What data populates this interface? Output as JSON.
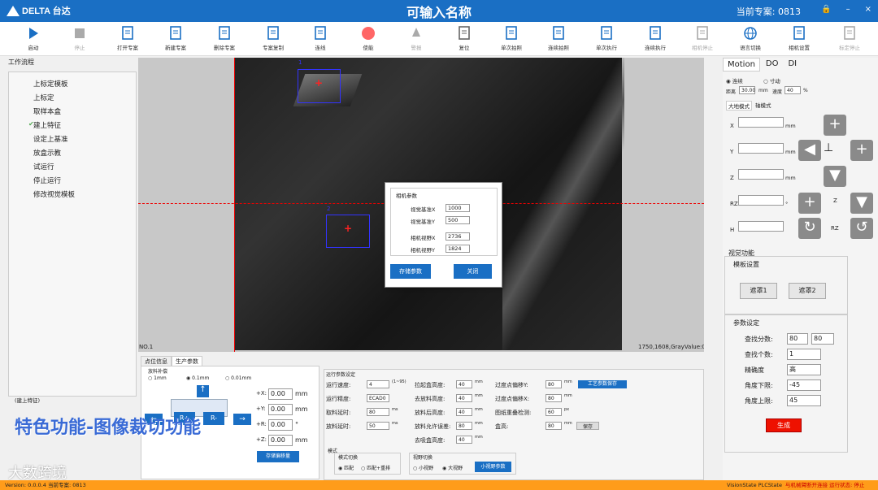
{
  "titlebar": {
    "brand": "DELTA 台达",
    "title": "可输入名称",
    "project_label": "当前专案: 0813",
    "lock": "🔒",
    "min": "–",
    "close": "×"
  },
  "toolbar": [
    {
      "label": "启动",
      "icon": "play-icon",
      "color": "#1a6fc4",
      "disabled": false
    },
    {
      "label": "停止",
      "icon": "stop-icon",
      "color": "#aaa",
      "disabled": true
    },
    {
      "label": "打开专案",
      "icon": "open-doc-icon",
      "color": "#1a6fc4",
      "disabled": false
    },
    {
      "label": "新建专案",
      "icon": "new-doc-icon",
      "color": "#1a6fc4",
      "disabled": false
    },
    {
      "label": "删除专案",
      "icon": "delete-doc-icon",
      "color": "#1a6fc4",
      "disabled": false
    },
    {
      "label": "专案复制",
      "icon": "copy-doc-icon",
      "color": "#1a6fc4",
      "disabled": false
    },
    {
      "label": "连线",
      "icon": "connect-icon",
      "color": "#1a6fc4",
      "disabled": false
    },
    {
      "label": "使能",
      "icon": "enable-icon",
      "color": "#f66",
      "disabled": false
    },
    {
      "label": "警报",
      "icon": "alarm-icon",
      "color": "#aaa",
      "disabled": true
    },
    {
      "label": "复位",
      "icon": "reset-icon",
      "color": "#666",
      "disabled": false
    },
    {
      "label": "单次拍照",
      "icon": "single-shot-icon",
      "color": "#1a6fc4",
      "disabled": false
    },
    {
      "label": "连续拍照",
      "icon": "continuous-shot-icon",
      "color": "#1a6fc4",
      "disabled": false
    },
    {
      "label": "单次执行",
      "icon": "single-run-icon",
      "color": "#1a6fc4",
      "disabled": false
    },
    {
      "label": "连续执行",
      "icon": "continuous-run-icon",
      "color": "#1a6fc4",
      "disabled": false
    },
    {
      "label": "相机停止",
      "icon": "camera-stop-icon",
      "color": "#aaa",
      "disabled": true
    },
    {
      "label": "语言切换",
      "icon": "globe-icon",
      "color": "#1a6fc4",
      "disabled": false
    },
    {
      "label": "相机设置",
      "icon": "camera-settings-icon",
      "color": "#1a6fc4",
      "disabled": false
    },
    {
      "label": "标定停止",
      "icon": "calib-stop-icon",
      "color": "#aaa",
      "disabled": true
    }
  ],
  "workflow": {
    "title": "工作流程",
    "items": [
      "上标定模板",
      "上标定",
      "取样本盒",
      "建上特征",
      "设定上基准",
      "放盒示教",
      "试运行",
      "停止运行",
      "修改视觉模板"
    ],
    "checked_index": 3,
    "status": "(建上特征)"
  },
  "canvas": {
    "no_label": "NO.1",
    "status_text": "1750,1608,GrayValue:0",
    "roi1_label": "1",
    "roi2_label": "2"
  },
  "dialog": {
    "group": "相机参数",
    "rows": [
      {
        "label": "视觉基准X",
        "value": "1000"
      },
      {
        "label": "视觉基准Y",
        "value": "500"
      },
      {
        "label": "相机视野X",
        "value": "2736"
      },
      {
        "label": "相机视野Y",
        "value": "1824"
      }
    ],
    "save": "存储参数",
    "close": "关闭"
  },
  "bottom": {
    "tabs": [
      "点位信息",
      "生产参数"
    ],
    "feed_title": "放料补偿",
    "step_options": [
      "1mm",
      "0.1mm",
      "0.01mm"
    ],
    "step_selected": 1,
    "r_minus": "R+",
    "r_plus": "R-",
    "axes": [
      {
        "label": "+X:",
        "value": "0.00",
        "unit": "mm"
      },
      {
        "label": "+Y:",
        "value": "0.00",
        "unit": "mm"
      },
      {
        "label": "+R:",
        "value": "0.00",
        "unit": "°"
      },
      {
        "label": "+Z:",
        "value": "0.00",
        "unit": "mm"
      }
    ],
    "save_comp": "存储偏移量",
    "run_title": "运行参数设定",
    "col1": [
      {
        "label": "运行速度:",
        "value": "4",
        "unit": "(1~95)"
      },
      {
        "label": "运行精度:",
        "value": "ECAD0",
        "unit": ""
      },
      {
        "label": "取料延时:",
        "value": "80",
        "unit": "ms"
      },
      {
        "label": "放料延时:",
        "value": "50",
        "unit": "ms"
      }
    ],
    "col2": [
      {
        "label": "拉起盒高度:",
        "value": "40",
        "unit": "mm"
      },
      {
        "label": "去放料高度:",
        "value": "40",
        "unit": "mm"
      },
      {
        "label": "放料后高度:",
        "value": "40",
        "unit": "mm"
      },
      {
        "label": "放料允许误差:",
        "value": "80",
        "unit": "mm"
      },
      {
        "label": "去吸盒高度:",
        "value": "40",
        "unit": "mm"
      }
    ],
    "col3": [
      {
        "label": "过度点偏移Y:",
        "value": "80",
        "unit": "mm"
      },
      {
        "label": "过度点偏移X:",
        "value": "80",
        "unit": "mm"
      },
      {
        "label": "图纸重叠检测:",
        "value": "60",
        "unit": "px"
      },
      {
        "label": "盒高:",
        "value": "80",
        "unit": "mm"
      }
    ],
    "craft_save": "工艺参数保存",
    "save_small": "保存",
    "mode_title": "模式",
    "mode_switch": "模式切换",
    "mode_opts": [
      "匹配",
      "匹配+重排"
    ],
    "view_title": "视野切换",
    "view_opts": [
      "小视野",
      "大视野"
    ],
    "view_param": "小视野参数"
  },
  "overlay": "特色功能-图像裁切功能",
  "watermark": "大数跨境",
  "right": {
    "tabs": [
      "Motion",
      "DO",
      "DI"
    ],
    "move_modes": [
      "连续",
      "寸动"
    ],
    "dist_label": "距离",
    "dist_value": "30.00",
    "dist_unit": "mm",
    "speed_label": "速度",
    "speed_value": "40",
    "speed_unit": "%",
    "subtabs": [
      "大地模式",
      "轴模式"
    ],
    "axes": [
      {
        "label": "X",
        "unit": "mm"
      },
      {
        "label": "Y",
        "unit": "mm"
      },
      {
        "label": "Z",
        "unit": "mm"
      },
      {
        "label": "RZ",
        "unit": "°"
      },
      {
        "label": "H",
        "unit": ""
      }
    ],
    "z_label": "Z",
    "rz_label": "RZ",
    "vision_title": "视觉功能",
    "template_title": "模板设置",
    "mask1": "遮罩1",
    "mask2": "遮罩2",
    "param_title": "参数设定",
    "params": [
      {
        "label": "查找分数:",
        "v1": "80",
        "v2": "80"
      },
      {
        "label": "查找个数:",
        "v1": "1"
      },
      {
        "label": "精确度",
        "v1": "高"
      },
      {
        "label": "角度下限:",
        "v1": "-45"
      },
      {
        "label": "角度上限:",
        "v1": "45"
      }
    ],
    "generate": "生成"
  },
  "statusbar": {
    "version": "Version: 0.0.0.4   当前专案: 0813",
    "right": "VisionState  PLCState",
    "alert": "与机械臂断开连接  运行状态: 停止"
  }
}
